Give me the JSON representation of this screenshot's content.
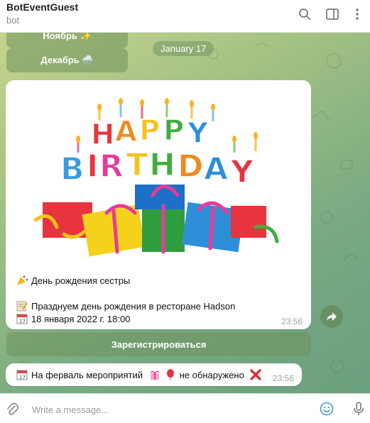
{
  "header": {
    "title": "BotEventGuest",
    "subtitle": "bot"
  },
  "keyboard_top": {
    "november_label": "Ноябрь ✨",
    "december_label": "Декабрь 🌨️"
  },
  "date_pill": "January 17",
  "event_message": {
    "image_text": "HAPPY BIRTHDAY",
    "title_line": "День рождения сестры",
    "description_line": "Празднуем день рождения в ресторане Hadson",
    "date_line": "18 января 2022 г. 18:00",
    "time": "23:56"
  },
  "register_button": "Зарегистрироваться",
  "info_message": {
    "text_part1": "На ферваль мероприятий",
    "text_part2": "не обнаружено",
    "time": "23:56"
  },
  "input": {
    "placeholder": "Write a message..."
  },
  "colors": {
    "accent": "#6a9f7f",
    "button_bg": "#6e915f"
  }
}
